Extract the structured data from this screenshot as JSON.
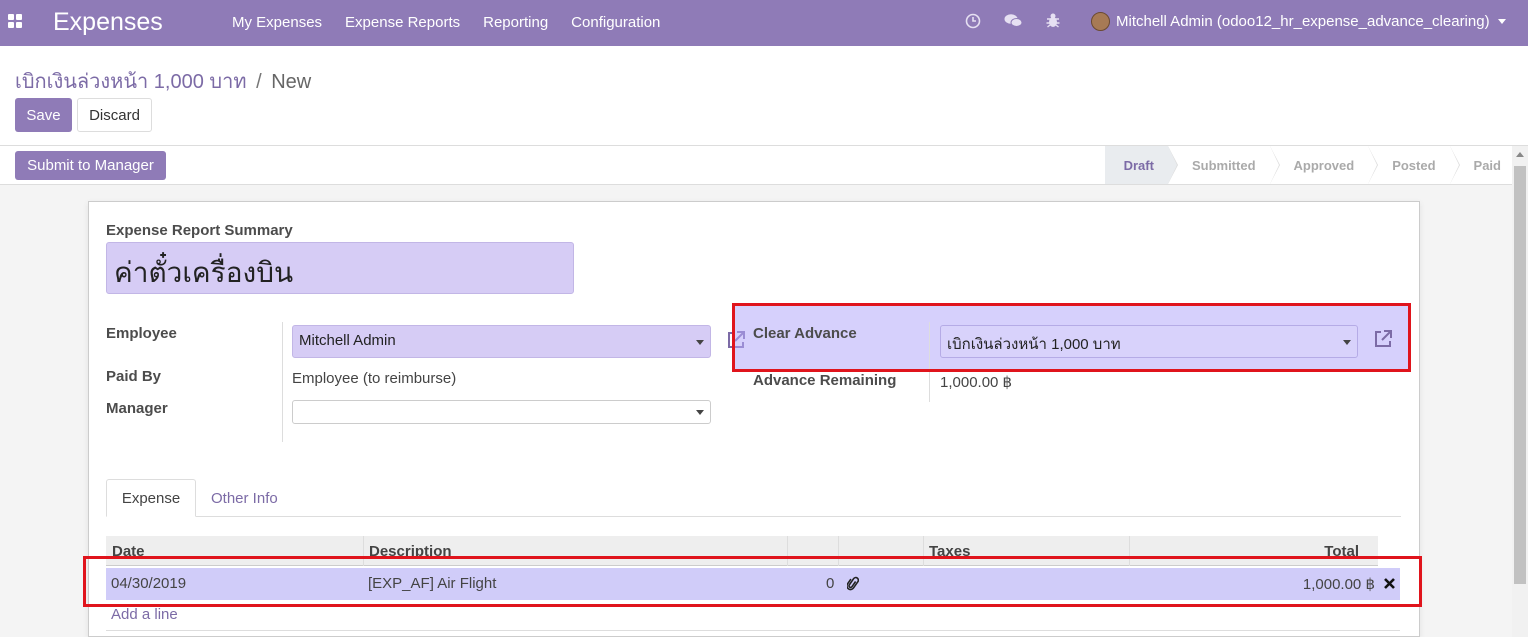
{
  "navbar": {
    "brand": "Expenses",
    "menu": [
      "My Expenses",
      "Expense Reports",
      "Reporting",
      "Configuration"
    ],
    "user": "Mitchell Admin (odoo12_hr_expense_advance_clearing)",
    "icons": [
      "apps-icon",
      "clock-icon",
      "chat-icon",
      "bug-icon"
    ]
  },
  "breadcrumb": {
    "parent": "เบิกเงินล่วงหน้า 1,000 บาท",
    "separator": "/",
    "current": "New"
  },
  "buttons": {
    "save": "Save",
    "discard": "Discard",
    "submit": "Submit to Manager"
  },
  "stages": [
    "Draft",
    "Submitted",
    "Approved",
    "Posted",
    "Paid"
  ],
  "active_stage": "Draft",
  "form": {
    "summary_label": "Expense Report Summary",
    "summary_value": "ค่าตั๋วเครื่องบิน",
    "employee_label": "Employee",
    "employee_value": "Mitchell Admin",
    "paid_by_label": "Paid By",
    "paid_by_value": "Employee (to reimburse)",
    "manager_label": "Manager",
    "manager_value": "",
    "clear_advance_label": "Clear Advance",
    "clear_advance_value": "เบิกเงินล่วงหน้า 1,000 บาท",
    "advance_remaining_label": "Advance Remaining",
    "advance_remaining_value": "1,000.00 ฿"
  },
  "tabs": [
    "Expense",
    "Other Info"
  ],
  "table": {
    "headers": [
      "Date",
      "Description",
      "Taxes",
      "Total"
    ],
    "rows": [
      {
        "date": "04/30/2019",
        "description": "[EXP_AF] Air Flight",
        "attachments": "0",
        "taxes": "",
        "total": "1,000.00 ฿"
      }
    ],
    "add_line": "Add a line"
  },
  "colors": {
    "brand": "#8f7bb7",
    "link": "#7c6ba6",
    "required_field": "#d6ccf5",
    "highlight": "#d0ccf9",
    "annotation": "#e0141c"
  }
}
